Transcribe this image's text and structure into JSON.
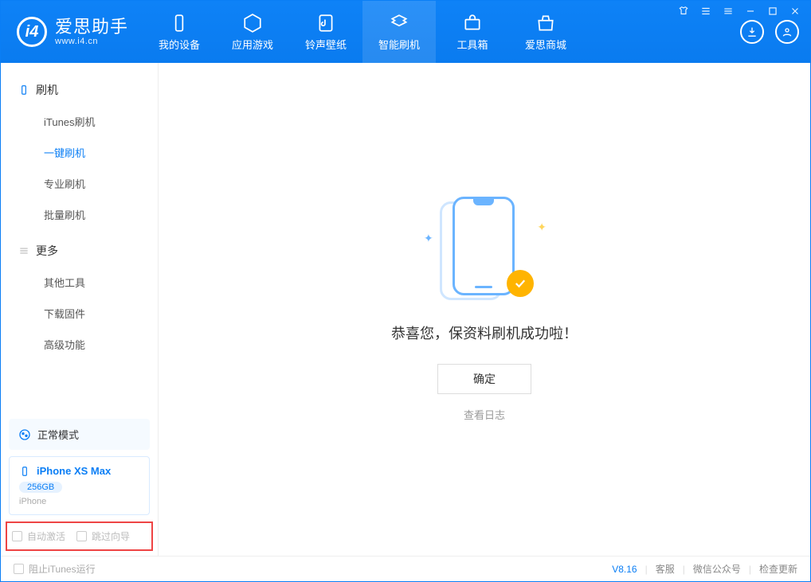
{
  "brand": {
    "name": "爱思助手",
    "url": "www.i4.cn"
  },
  "tabs": [
    {
      "label": "我的设备"
    },
    {
      "label": "应用游戏"
    },
    {
      "label": "铃声壁纸"
    },
    {
      "label": "智能刷机"
    },
    {
      "label": "工具箱"
    },
    {
      "label": "爱思商城"
    }
  ],
  "sidebar": {
    "sec1_title": "刷机",
    "sec1_items": [
      "iTunes刷机",
      "一键刷机",
      "专业刷机",
      "批量刷机"
    ],
    "sec1_active_index": 1,
    "sec2_title": "更多",
    "sec2_items": [
      "其他工具",
      "下载固件",
      "高级功能"
    ]
  },
  "mode_card": {
    "label": "正常模式"
  },
  "device": {
    "name": "iPhone XS Max",
    "capacity": "256GB",
    "type": "iPhone"
  },
  "options": {
    "auto_activate": "自动激活",
    "skip_guide": "跳过向导"
  },
  "main": {
    "success_msg": "恭喜您，保资料刷机成功啦！",
    "ok_label": "确定",
    "view_log": "查看日志"
  },
  "footer": {
    "block_itunes": "阻止iTunes运行",
    "version": "V8.16",
    "links": [
      "客服",
      "微信公众号",
      "检查更新"
    ]
  }
}
